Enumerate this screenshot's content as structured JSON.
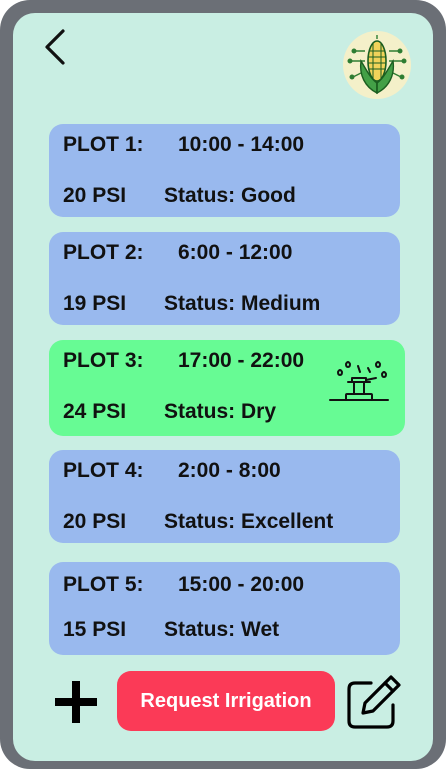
{
  "header": {
    "back_icon": "chevron-left-icon",
    "logo_icon": "corn-circuit-logo"
  },
  "plots": [
    {
      "label": "PLOT 1:",
      "time": "10:00 - 14:00",
      "pressure": "20 PSI",
      "status": "Status: Good"
    },
    {
      "label": "PLOT 2:",
      "time": "6:00 - 12:00",
      "pressure": "19 PSI",
      "status": "Status: Medium"
    },
    {
      "label": "PLOT 3:",
      "time": "17:00 - 22:00",
      "pressure": "24 PSI",
      "status": "Status: Dry",
      "icon": "sprinkler-icon"
    },
    {
      "label": "PLOT 4:",
      "time": "2:00 - 8:00",
      "pressure": "20 PSI",
      "status": "Status: Excellent"
    },
    {
      "label": "PLOT 5:",
      "time": "15:00 - 20:00",
      "pressure": "15 PSI",
      "status": "Status: Wet"
    }
  ],
  "footer": {
    "add_icon": "plus-icon",
    "request_label": "Request Irrigation",
    "edit_icon": "edit-icon"
  },
  "colors": {
    "device_frame": "#6b6f76",
    "screen_bg": "#c9eee3",
    "card_normal": "#99b9ee",
    "card_dry": "#67fb94",
    "request_button": "#fb3a57"
  }
}
